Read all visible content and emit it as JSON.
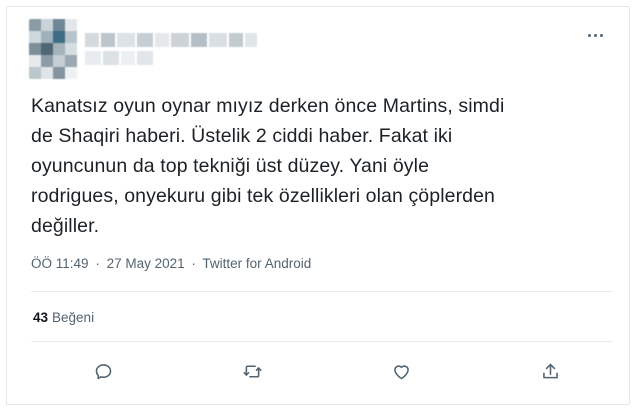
{
  "tweet": {
    "text": "Kanatsız oyun oynar mıyız derken önce Martins, simdi\nde Shaqiri haberi. Üstelik 2 ciddi haber. Fakat iki\noyuncunun da top tekniği üst düzey. Yani öyle\nrodrigues, onyekuru gibi tek özellikleri olan çöplerden\ndeğiller.",
    "time": "ÖÖ 11:49",
    "separator": "·",
    "date": "27 May 2021",
    "client": "Twitter for Android"
  },
  "engagement": {
    "likes_count": "43",
    "likes_label": "Beğeni"
  },
  "icons": {
    "more": "more-options-icon",
    "reply": "reply-icon",
    "retweet": "retweet-icon",
    "like": "heart-icon",
    "share": "share-icon"
  },
  "colors": {
    "text": "#1c2126",
    "secondary": "#536471",
    "border": "#e1e8ed"
  }
}
